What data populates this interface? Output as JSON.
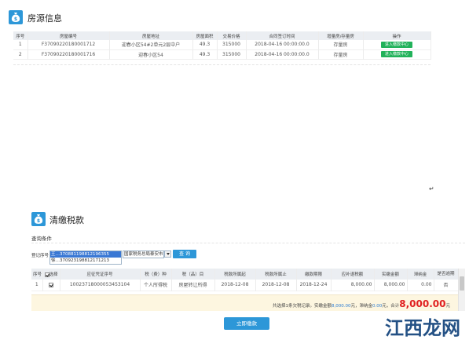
{
  "house_section": {
    "title": "房源信息",
    "columns": [
      "序号",
      "房屋编号",
      "房屋地址",
      "房屋面积",
      "交易价格",
      "合同签订时间",
      "增量房/存量房",
      "操作"
    ],
    "rows": [
      {
        "index": "1",
        "code": "F37090220180001712",
        "address": "迎春小区54#2单元2层中户",
        "area": "49.3",
        "price": "315000",
        "signed": "2018-04-16 00:00:00.0",
        "kind": "存量房",
        "action": "进入缴款中心"
      },
      {
        "index": "2",
        "code": "F37090220180001716",
        "address": "迎春小区54",
        "area": "49.3",
        "price": "315000",
        "signed": "2018-04-16 00:00:00.0",
        "kind": "存量房",
        "action": "进入缴款中心"
      }
    ]
  },
  "return_mark": "↵",
  "tax_section": {
    "title": "清缴税款",
    "query_heading": "查询条件",
    "query": {
      "label": "登记序号",
      "options": [
        "王…370881198812196355",
        "徐…370923198812171213"
      ],
      "selected_index": 0,
      "authority": "国家税务总局泰安市",
      "search_button": "查 询"
    },
    "columns": [
      "序号",
      "选择",
      "应征凭证序号",
      "税（费）种",
      "税（品）目",
      "税款所属起",
      "税款所属止",
      "缴款期限",
      "应补退税额",
      "实缴金额",
      "滞纳金",
      "是否逾期"
    ],
    "rows": [
      {
        "index": "1",
        "checked": true,
        "voucher": "10023718000053453104",
        "tax_type": "个人所得税",
        "tax_item": "房屋转让所得",
        "period_start": "2018-12-08",
        "period_end": "2018-12-08",
        "deadline": "2018-12-24",
        "due": "8,000.00",
        "paid": "8,000.00",
        "late_fee": "0.00",
        "overdue": "否"
      }
    ],
    "header_checked": true,
    "summary": {
      "prefix": "共选择1条欠税记录。实缴金额",
      "paid_amount": "8,000.00",
      "mid1": "元，滞纳金",
      "late_amount": "0.00",
      "mid2": "元，合计",
      "total": "8,000.00",
      "suffix": "元"
    },
    "submit_button": "立即缴款"
  },
  "watermark": "江西龙网",
  "colors": {
    "accent_blue": "#2d97d8",
    "action_green": "#22b25a",
    "total_red": "#e02020",
    "summary_bg": "#fdf6e0"
  },
  "icons": {
    "section_icon": "money-bag-icon"
  }
}
